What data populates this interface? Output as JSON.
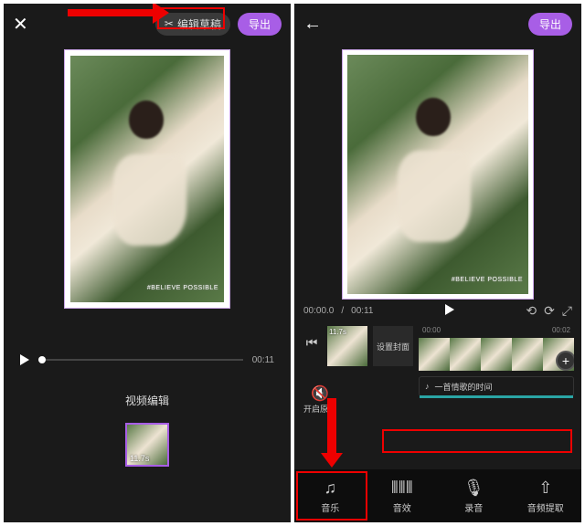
{
  "left": {
    "edit_draft": "编辑草稿",
    "export": "导出",
    "watermark": "#BELIEVE POSSIBLE",
    "duration_label": "00:11",
    "section_label": "视频编辑",
    "clip_duration": "11.7s"
  },
  "right": {
    "export": "导出",
    "watermark": "#BELIEVE POSSIBLE",
    "time_current": "00:00.0",
    "time_total": "00:11",
    "tick_a": "00:00",
    "tick_b": "00:02",
    "clip_duration": "11.7s",
    "cover_label": "设置封面",
    "mute_label": "开启原声",
    "audio_label": "一首情歌的时间",
    "tabs": {
      "music": "音乐",
      "sfx": "音效",
      "record": "录音",
      "extract": "音频提取"
    }
  }
}
